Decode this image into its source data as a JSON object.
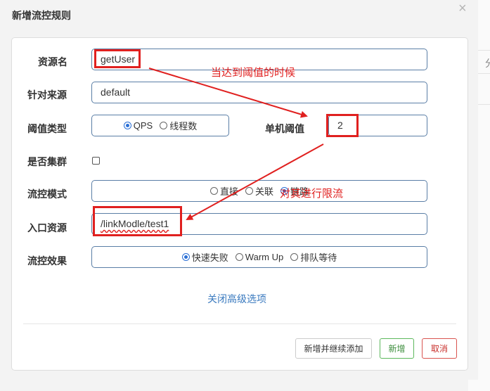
{
  "dialog": {
    "title": "新增流控规则",
    "close_glyph": "×"
  },
  "background": {
    "right_char": "分"
  },
  "form": {
    "resource_name": {
      "label": "资源名",
      "value": "getUser"
    },
    "limit_app": {
      "label": "针对来源",
      "value": "default"
    },
    "threshold_type": {
      "label": "阈值类型",
      "options": [
        {
          "label": "QPS",
          "checked": true
        },
        {
          "label": "线程数",
          "checked": false
        }
      ]
    },
    "single_threshold": {
      "label": "单机阈值",
      "value": "2"
    },
    "cluster": {
      "label": "是否集群",
      "checked": false
    },
    "flow_mode": {
      "label": "流控模式",
      "options": [
        {
          "label": "直接",
          "checked": false
        },
        {
          "label": "关联",
          "checked": false
        },
        {
          "label": "链路",
          "checked": true
        }
      ]
    },
    "entry_resource": {
      "label": "入口资源",
      "value": "/linkModle/test1"
    },
    "control_effect": {
      "label": "流控效果",
      "options": [
        {
          "label": "快速失败",
          "checked": true
        },
        {
          "label": "Warm Up",
          "checked": false
        },
        {
          "label": "排队等待",
          "checked": false
        }
      ]
    },
    "advanced_link": "关闭高级选项"
  },
  "buttons": {
    "add_continue": "新增并继续添加",
    "add": "新增",
    "cancel": "取消"
  },
  "annotations": {
    "note1": "当达到阈值的时候",
    "note2": "对其进行限流",
    "color": "#e0201f"
  },
  "colors": {
    "field_border": "#5a7ea6",
    "radio_checked": "#2a6fd6",
    "link": "#3a7abf",
    "success": "#5cb85c",
    "danger": "#d9534f"
  }
}
